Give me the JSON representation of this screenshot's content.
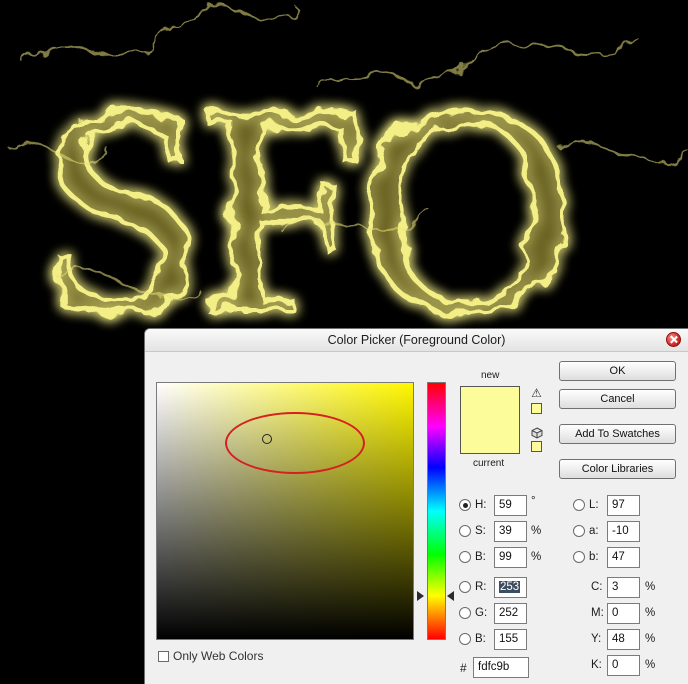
{
  "artwork": {
    "text": "SFO",
    "glow_color": "#f3ef86"
  },
  "dialog": {
    "title": "Color Picker (Foreground Color)",
    "new_label": "new",
    "current_label": "current",
    "new_color": "#fdfc9b",
    "current_color": "#fdfc9b",
    "buttons": {
      "ok": "OK",
      "cancel": "Cancel",
      "add_to_swatches": "Add To Swatches",
      "color_libraries": "Color Libraries"
    },
    "hsb": {
      "h": {
        "label": "H:",
        "value": "59",
        "unit": "°",
        "selected": true
      },
      "s": {
        "label": "S:",
        "value": "39",
        "unit": "%"
      },
      "b": {
        "label": "B:",
        "value": "99",
        "unit": "%"
      }
    },
    "lab": {
      "l": {
        "label": "L:",
        "value": "97"
      },
      "a": {
        "label": "a:",
        "value": "-10"
      },
      "b": {
        "label": "b:",
        "value": "47"
      }
    },
    "rgb": {
      "r": {
        "label": "R:",
        "value": "253"
      },
      "g": {
        "label": "G:",
        "value": "252"
      },
      "b": {
        "label": "B:",
        "value": "155"
      }
    },
    "cmyk": {
      "c": {
        "label": "C:",
        "value": "3",
        "unit": "%"
      },
      "m": {
        "label": "M:",
        "value": "0",
        "unit": "%"
      },
      "y": {
        "label": "Y:",
        "value": "48",
        "unit": "%"
      },
      "k": {
        "label": "K:",
        "value": "0",
        "unit": "%"
      }
    },
    "hex": {
      "label": "#",
      "value": "fdfc9b"
    },
    "only_web_colors": {
      "label": "Only Web Colors",
      "checked": false
    },
    "icons": [
      "gamut-warning-icon",
      "websafe-cube-icon",
      "close-icon"
    ],
    "annotation_color": "#d61f1f"
  }
}
